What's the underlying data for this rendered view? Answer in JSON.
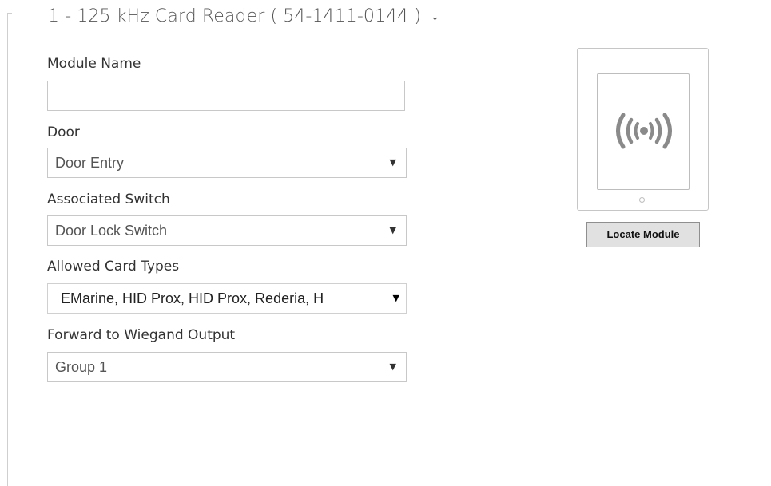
{
  "section": {
    "title": "1 - 125 kHz Card Reader ( 54-1411-0144 )",
    "toggle_icon": "chevron-down-icon"
  },
  "form": {
    "module_name": {
      "label": "Module Name",
      "value": "",
      "placeholder": ""
    },
    "door": {
      "label": "Door",
      "selected": "Door Entry"
    },
    "associated_switch": {
      "label": "Associated Switch",
      "selected": "Door Lock Switch"
    },
    "allowed_card_types": {
      "label": "Allowed Card Types",
      "selected": "EMarine, HID Prox, HID Prox, Rederia, H"
    },
    "wiegand_output": {
      "label": "Forward to Wiegand Output",
      "selected": "Group 1"
    }
  },
  "device": {
    "icon": "rfid-icon",
    "locate_button_label": "Locate Module"
  },
  "colors": {
    "border": "#c8c8c8",
    "label_text": "#333333",
    "icon_gray": "#8a8a8a",
    "button_bg": "#e1e1e1"
  }
}
